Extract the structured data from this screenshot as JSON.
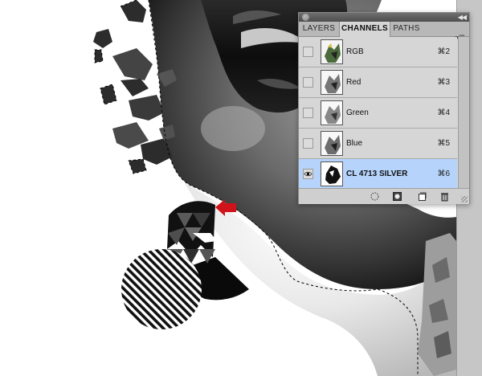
{
  "panel": {
    "tabs": [
      {
        "label": "LAYERS",
        "active": false
      },
      {
        "label": "CHANNELS",
        "active": true
      },
      {
        "label": "PATHS",
        "active": false
      }
    ],
    "channels": [
      {
        "name": "RGB",
        "shortcut": "⌘2",
        "visible": false,
        "selected": false
      },
      {
        "name": "Red",
        "shortcut": "⌘3",
        "visible": false,
        "selected": false
      },
      {
        "name": "Green",
        "shortcut": "⌘4",
        "visible": false,
        "selected": false
      },
      {
        "name": "Blue",
        "shortcut": "⌘5",
        "visible": false,
        "selected": false
      },
      {
        "name": "CL 4713 SILVER",
        "shortcut": "⌘6",
        "visible": true,
        "selected": true
      }
    ],
    "footer_icons": [
      "load-selection-icon",
      "save-selection-icon",
      "new-channel-icon",
      "trash-icon"
    ]
  },
  "colors": {
    "selection_highlight": "#b6d4fb",
    "arrow_marker": "#d0121b",
    "panel_bg": "#d6d6d6"
  }
}
